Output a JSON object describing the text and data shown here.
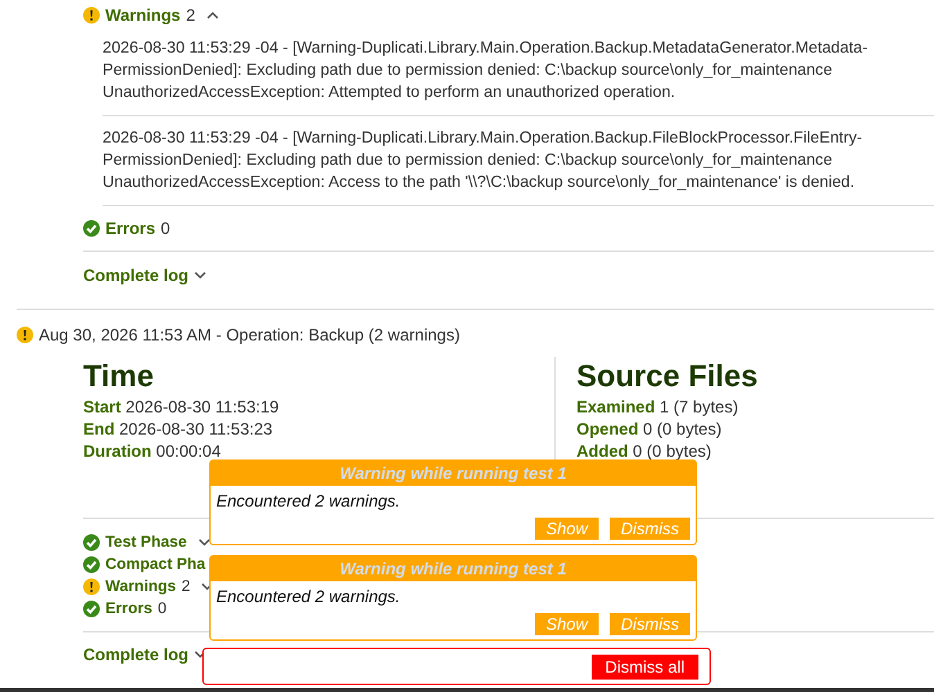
{
  "previous_entry": {
    "sections": [
      {
        "kind": "warning",
        "label": "Warnings",
        "count": "2",
        "expanded": true,
        "messages": [
          {
            "lines": [
              "2026-08-30 11:53:29 -04 - [Warning-Duplicati.Library.Main.Operation.Backup.MetadataGenerator.Metadata-",
              "PermissionDenied]: Excluding path due to permission denied: C:\\backup source\\only_for_maintenance",
              "UnauthorizedAccessException: Attempted to perform an unauthorized operation."
            ]
          },
          {
            "lines": [
              "2026-08-30 11:53:29 -04 - [Warning-Duplicati.Library.Main.Operation.Backup.FileBlockProcessor.FileEntry-",
              "PermissionDenied]: Excluding path due to permission denied: C:\\backup source\\only_for_maintenance",
              "UnauthorizedAccessException: Access to the path '\\\\?\\C:\\backup source\\only_for_maintenance' is denied."
            ]
          }
        ]
      },
      {
        "kind": "ok",
        "label": "Errors",
        "count": "0"
      }
    ],
    "complete_log": {
      "label": "Complete log",
      "expanded": false
    }
  },
  "entry": {
    "kind": "warning",
    "title": "Aug 30, 2026 11:53 AM - Operation: Backup (2 warnings)",
    "time": {
      "heading": "Time",
      "rows": [
        {
          "label": "Start",
          "value": "2026-08-30 11:53:19"
        },
        {
          "label": "End",
          "value": "2026-08-30 11:53:23"
        },
        {
          "label": "Duration",
          "value": "00:00:04"
        }
      ]
    },
    "source_files": {
      "heading": "Source Files",
      "rows": [
        {
          "label": "Examined",
          "value": "1 (7 bytes)"
        },
        {
          "label": "Opened",
          "value": "0 (0 bytes)"
        },
        {
          "label": "Added",
          "value": "0 (0 bytes)"
        }
      ]
    },
    "phases": [
      {
        "kind": "ok",
        "label": "Test Phase",
        "expanded": false
      },
      {
        "kind": "ok",
        "label": "Compact Pha"
      },
      {
        "kind": "warning",
        "label": "Warnings",
        "count": "2",
        "expanded": false
      },
      {
        "kind": "ok",
        "label": "Errors",
        "count": "0"
      }
    ],
    "complete_log": {
      "label": "Complete log",
      "expanded": false
    }
  },
  "toasts": [
    {
      "title": "Warning while running test 1",
      "message": "Encountered 2 warnings.",
      "buttons": [
        "Show",
        "Dismiss"
      ]
    },
    {
      "title": "Warning while running test 1",
      "message": "Encountered 2 warnings.",
      "buttons": [
        "Show",
        "Dismiss"
      ]
    }
  ],
  "dismiss_all": "Dismiss all"
}
